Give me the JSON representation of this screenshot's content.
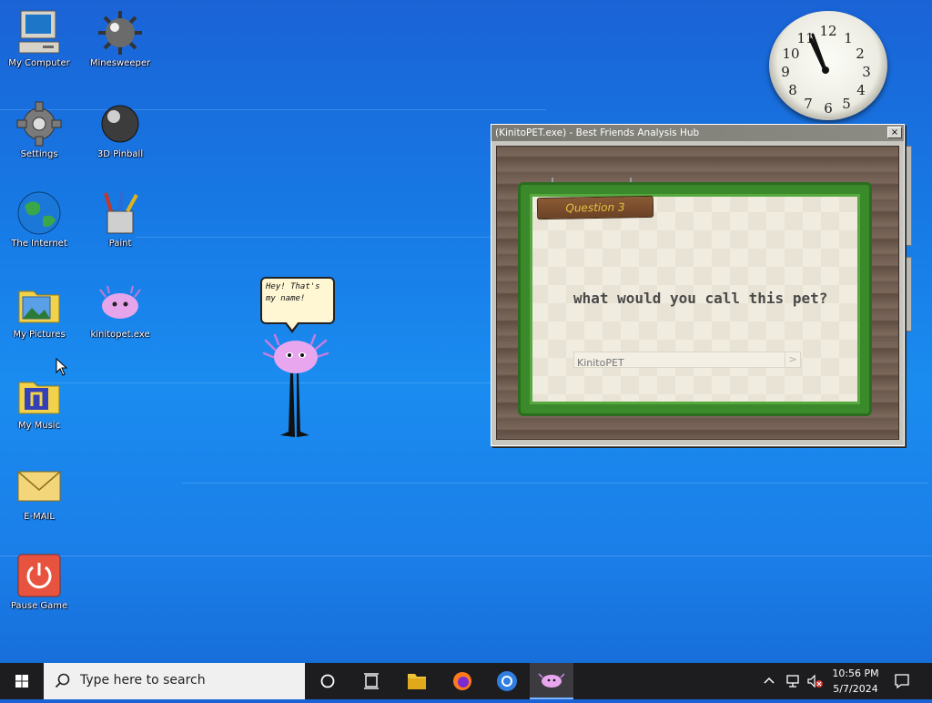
{
  "desktop": {
    "icons": [
      {
        "label": "My Computer"
      },
      {
        "label": "Minesweeper"
      },
      {
        "label": "Settings"
      },
      {
        "label": "3D Pinball"
      },
      {
        "label": "The Internet"
      },
      {
        "label": "Paint"
      },
      {
        "label": "My Pictures"
      },
      {
        "label": "kinitopet.exe"
      },
      {
        "label": "My Music"
      },
      {
        "label": "E-MAIL"
      },
      {
        "label": "Pause Game"
      }
    ],
    "speech_bubble": "Hey! That's my name!"
  },
  "clock": {
    "numbers": [
      "12",
      "1",
      "2",
      "3",
      "4",
      "5",
      "6",
      "7",
      "8",
      "9",
      "10",
      "11"
    ]
  },
  "window": {
    "title": "(KinitoPET.exe) - Best Friends Analysis Hub",
    "close_label": "×",
    "sign": "Question 3",
    "question": "what would you call this pet?",
    "answer_value": "",
    "answer_placeholder": "KinitoPET",
    "submit_label": ">"
  },
  "taskbar": {
    "search_placeholder": "Type here to search",
    "time": "10:56 PM",
    "date": "5/7/2024"
  },
  "colors": {
    "desktop_blue": "#1779e4",
    "taskbar": "#1d1d20",
    "hedge_green": "#3a8a2b",
    "sign_text": "#e7c241"
  }
}
